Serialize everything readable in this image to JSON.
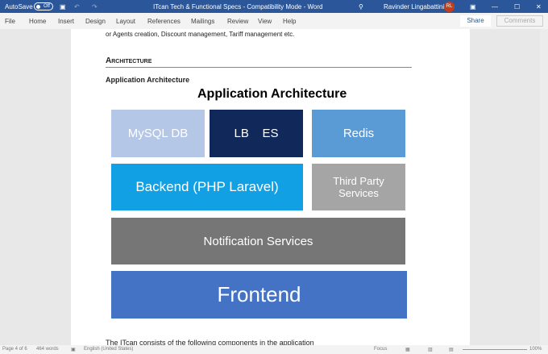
{
  "titlebar": {
    "autosave": "AutoSave",
    "toggle": "Off",
    "title": "ITcan Tech & Functional Specs  -  Compatibility Mode  -  Word",
    "user": "Ravinder Lingabattini",
    "initials": "RL"
  },
  "ribbon": {
    "tabs": [
      "File",
      "Home",
      "Insert",
      "Design",
      "Layout",
      "References",
      "Mailings",
      "Review",
      "View",
      "Help"
    ],
    "share": "Share",
    "comments": "Comments"
  },
  "doc": {
    "line_top": "or Agents creation, Discount management, Tariff management etc.",
    "heading": "Architecture",
    "subheading": "Application Architecture",
    "diagram_title": "Application Architecture",
    "boxes": [
      "MySQL DB",
      "LB    ES",
      "Redis",
      "Backend (PHP Laravel)",
      "Third Party Services",
      "Notification Services",
      "Frontend"
    ],
    "line_bottom": "The ITcan consists of the following components in the application"
  },
  "status": {
    "page": "Page 4 of 6",
    "words": "464 words",
    "language": "English (United States)",
    "focus": "Focus",
    "zoom": "100%"
  }
}
